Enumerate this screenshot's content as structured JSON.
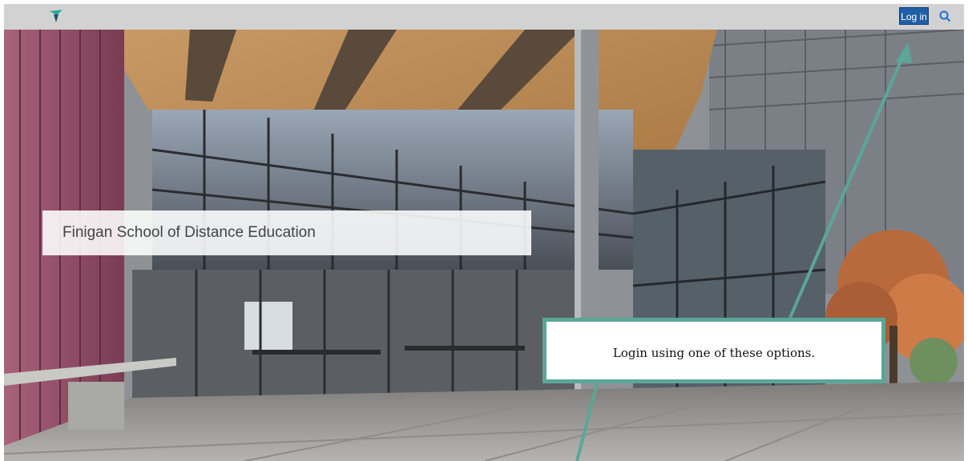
{
  "header": {
    "logo_icon": "bird-logo-icon",
    "login_label": "Log in",
    "search_icon": "search-icon",
    "colors": {
      "bar": "#d2d2d2",
      "login_bg": "#1f5fa6",
      "accent": "#28a8a0"
    }
  },
  "hero": {
    "title": "Finigan School of Distance Education",
    "image": "campus-courtyard-illustration"
  },
  "annotation": {
    "text": "Login using one of these options.",
    "border_color": "#5aa797",
    "arrow_color": "#5aa797"
  }
}
